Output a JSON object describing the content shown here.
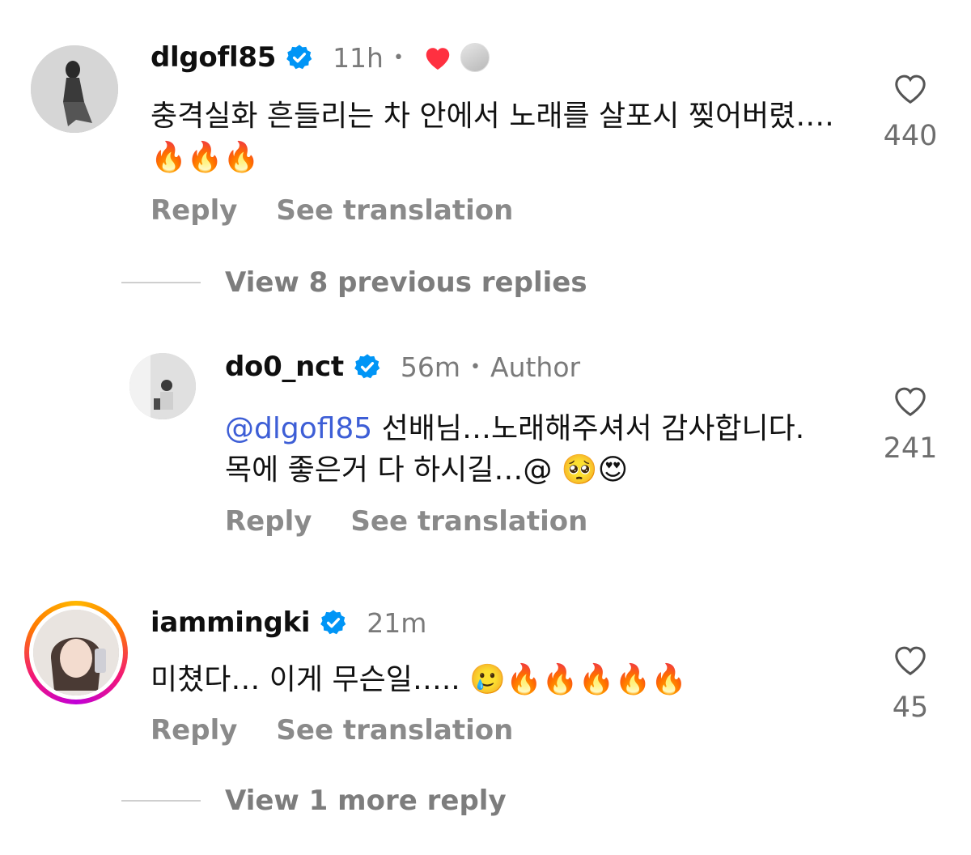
{
  "comments": [
    {
      "username": "dlgofl85",
      "time": "11h",
      "text": "충격실화 흔들리는 차 안에서 노래를 살포시 찢어버렸….🔥🔥🔥",
      "reply_label": "Reply",
      "translate_label": "See translation",
      "likes": "440"
    },
    {
      "username": "do0_nct",
      "time": "56m",
      "badge": "Author",
      "mention": "@dlgofl85",
      "text": " 선배님…노래해주셔서 감사합니다. 목에 좋은거 다 하시길…@ 🥺😍",
      "reply_label": "Reply",
      "translate_label": "See translation",
      "likes": "241"
    },
    {
      "username": "iammingki",
      "time": "21m",
      "text": "미쳤다… 이게 무슨일….. 🥲🔥🔥🔥🔥🔥",
      "reply_label": "Reply",
      "translate_label": "See translation",
      "likes": "45"
    }
  ],
  "view_previous": "View 8 previous replies",
  "view_more": "View 1 more reply",
  "colors": {
    "verified": "#0095f6",
    "heart_liked": "#ff3040",
    "mention": "#3d5ed6",
    "meta": "#7a7a7a"
  },
  "icons": [
    "verified-icon",
    "heart-outline-icon",
    "heart-filled-icon"
  ]
}
